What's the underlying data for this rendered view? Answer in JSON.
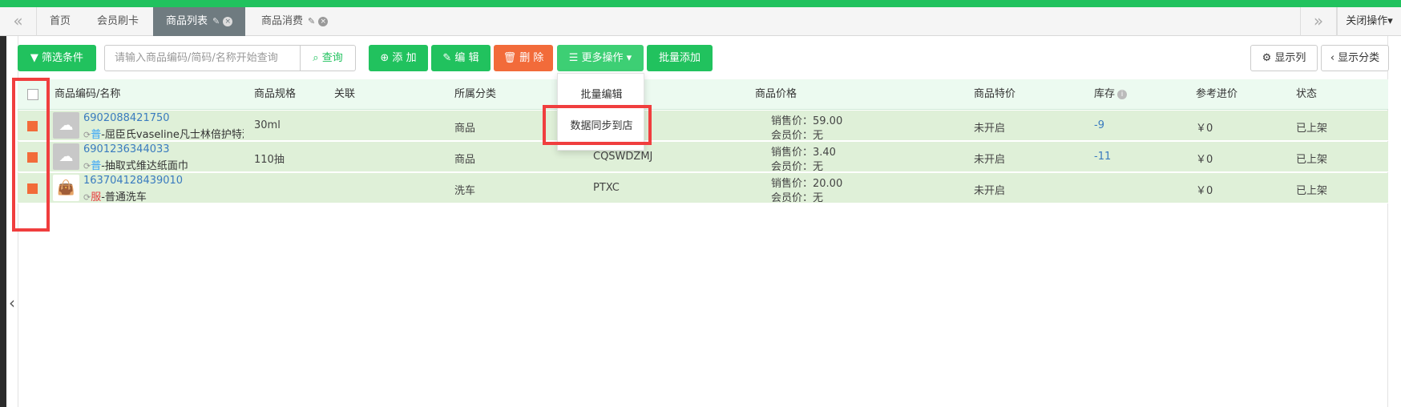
{
  "tabs": {
    "prev_icon": "double-chevron-left-icon",
    "next_icon": "double-chevron-right-icon",
    "prev_glyph": "«",
    "next_glyph": "»",
    "items": [
      {
        "label": "首页"
      },
      {
        "label": "会员刷卡"
      },
      {
        "label": "商品列表",
        "active": true
      },
      {
        "label": "商品消费"
      }
    ],
    "pin_glyph": "✎",
    "close_glyph": "×",
    "close_ops": "关闭操作▾"
  },
  "toolbar": {
    "filter_label": "▼ 筛选条件",
    "search_placeholder": "请输入商品编码/简码/名称开始查询",
    "search_label": "查询",
    "search_glyph": "⌕",
    "add_label": "⊕ 添 加",
    "edit_label": "✎ 编 辑",
    "delete_label": "🗑 删 除",
    "more_label": "☰ 更多操作 ▾",
    "batch_add_label": "批量添加",
    "show_cols_label": "⚙ 显示列",
    "show_cats_label": "‹ 显示分类"
  },
  "dropdown": {
    "items": [
      "批量编辑",
      "数据同步到店"
    ]
  },
  "table": {
    "headers": {
      "code_name": "商品编码/名称",
      "spec": "商品规格",
      "assoc": "关联",
      "category": "所属分类",
      "price": "商品价格",
      "special": "商品特价",
      "stock": "库存",
      "stock_info": "i",
      "cost": "参考进价",
      "status": "状态"
    },
    "rows": [
      {
        "code": "6902088421750",
        "sync": "⟳",
        "tag": "普",
        "name": "-屈臣氏vaseline凡士林倍护特润",
        "spec": "30ml",
        "category": "商品",
        "short_code": "",
        "sale_price": "销售价：59.00",
        "member_price": "会员价：无",
        "special": "未开启",
        "stock": "-9",
        "cost": "￥0",
        "status": "已上架",
        "thumb": "☁"
      },
      {
        "code": "6901236344033",
        "sync": "⟳",
        "tag": "普",
        "name": "-抽取式维达纸面巾",
        "spec": "110抽",
        "category": "商品",
        "short_code": "CQSWDZMJ",
        "sale_price": "销售价：3.40",
        "member_price": "会员价：无",
        "special": "未开启",
        "stock": "-11",
        "cost": "￥0",
        "status": "已上架",
        "thumb": "☁"
      },
      {
        "code": "163704128439010",
        "sync": "⟳",
        "tag": "服",
        "name": "-普通洗车",
        "spec": "",
        "category": "洗车",
        "short_code": "PTXC",
        "sale_price": "销售价：20.00",
        "member_price": "会员价：无",
        "special": "未开启",
        "stock": "",
        "cost": "￥0",
        "status": "已上架",
        "thumb": "👜"
      }
    ]
  },
  "side_collapse_glyph": "‹"
}
